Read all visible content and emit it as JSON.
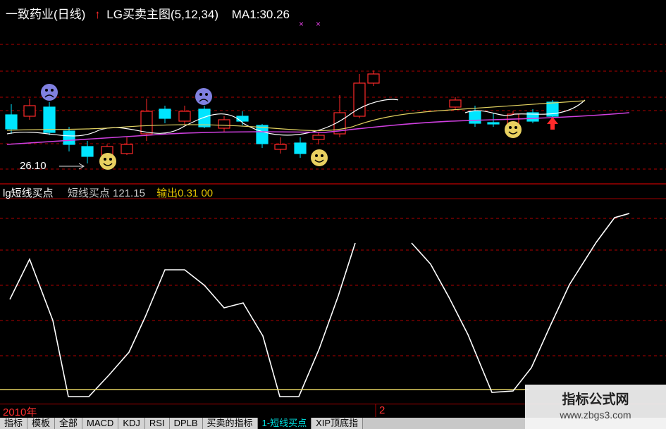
{
  "header": {
    "stock_title": "一致药业(日线)",
    "indicator": "LG买卖主图(5,12,34)",
    "ma_label": "MA1:30.26"
  },
  "annotation": {
    "low_price": "26.10"
  },
  "subchart": {
    "title": "lg短线买点",
    "value1": "短线买点 121.15",
    "value2": "输出0.31 00"
  },
  "x_axis": {
    "year_label": "2010年",
    "mid_label": "2"
  },
  "tabs": [
    "指标",
    "模板",
    "全部",
    "MACD",
    "KDJ",
    "RSI",
    "DPLB",
    "买卖的指标",
    "1-短线买点",
    "XIP顶底指"
  ],
  "active_tab": 8,
  "watermark": {
    "line1": "指标公式网",
    "line2": "www.zbgs3.com"
  },
  "colors": {
    "up": "#ff2a2a",
    "down": "#00e5ff",
    "ma_white": "#ffffff",
    "ma_yellow": "#e0d060",
    "ma_magenta": "#d040e0",
    "grid": "#b00000",
    "osc": "#ffffff",
    "baseline": "#e0d060"
  },
  "chart_data": {
    "type": "candlestick",
    "candles": [
      {
        "o": 163,
        "c": 183,
        "h": 148,
        "l": 190
      },
      {
        "o": 165,
        "c": 150,
        "h": 140,
        "l": 170
      },
      {
        "o": 152,
        "c": 188,
        "h": 145,
        "l": 192
      },
      {
        "o": 186,
        "c": 205,
        "h": 180,
        "l": 215
      },
      {
        "o": 208,
        "c": 222,
        "h": 200,
        "l": 232
      },
      {
        "o": 220,
        "c": 208,
        "h": 205,
        "l": 225
      },
      {
        "o": 218,
        "c": 205,
        "h": 195,
        "l": 220
      },
      {
        "o": 190,
        "c": 158,
        "h": 140,
        "l": 200
      },
      {
        "o": 155,
        "c": 168,
        "h": 150,
        "l": 175
      },
      {
        "o": 172,
        "c": 158,
        "h": 150,
        "l": 178
      },
      {
        "o": 155,
        "c": 180,
        "h": 150,
        "l": 182
      },
      {
        "o": 182,
        "c": 170,
        "h": 165,
        "l": 188
      },
      {
        "o": 165,
        "c": 172,
        "h": 158,
        "l": 178
      },
      {
        "o": 178,
        "c": 204,
        "h": 176,
        "l": 210
      },
      {
        "o": 212,
        "c": 205,
        "h": 195,
        "l": 218
      },
      {
        "o": 203,
        "c": 218,
        "h": 195,
        "l": 224
      },
      {
        "o": 198,
        "c": 192,
        "h": 188,
        "l": 205
      },
      {
        "o": 190,
        "c": 160,
        "h": 135,
        "l": 195
      },
      {
        "o": 165,
        "c": 118,
        "h": 105,
        "l": 168
      },
      {
        "o": 118,
        "c": 105,
        "h": 100,
        "l": 122
      },
      {
        "o": 152,
        "c": 142,
        "h": 138,
        "l": 156
      },
      {
        "o": 158,
        "c": 175,
        "h": 150,
        "l": 180
      },
      {
        "o": 174,
        "c": 174,
        "h": 160,
        "l": 180
      },
      {
        "o": 175,
        "c": 162,
        "h": 158,
        "l": 178
      },
      {
        "o": 160,
        "c": 172,
        "h": 155,
        "l": 175
      },
      {
        "o": 145,
        "c": 165,
        "h": 142,
        "l": 168
      }
    ],
    "osc_points": [
      [
        14,
        425
      ],
      [
        42,
        368
      ],
      [
        75,
        455
      ],
      [
        97,
        563
      ],
      [
        126,
        563
      ],
      [
        155,
        532
      ],
      [
        183,
        500
      ],
      [
        206,
        450
      ],
      [
        234,
        383
      ],
      [
        262,
        383
      ],
      [
        290,
        405
      ],
      [
        318,
        437
      ],
      [
        345,
        430
      ],
      [
        373,
        477
      ],
      [
        397,
        563
      ],
      [
        424,
        563
      ],
      [
        453,
        495
      ],
      [
        480,
        420
      ],
      [
        504,
        345
      ],
      [
        584,
        345
      ],
      [
        611,
        375
      ],
      [
        637,
        422
      ],
      [
        664,
        475
      ],
      [
        698,
        557
      ],
      [
        728,
        555
      ],
      [
        754,
        522
      ],
      [
        781,
        462
      ],
      [
        808,
        404
      ],
      [
        846,
        344
      ],
      [
        872,
        309
      ],
      [
        893,
        303
      ]
    ]
  }
}
